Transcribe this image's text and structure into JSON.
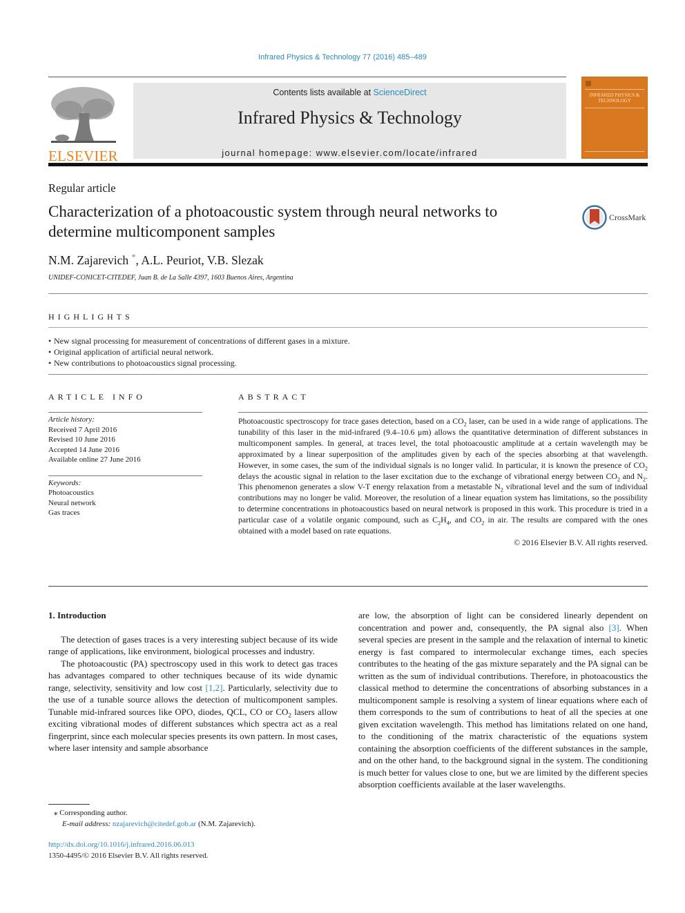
{
  "header": {
    "citation": "Infrared Physics & Technology 77 (2016) 485–489",
    "contents_prefix": "Contents lists available at ",
    "contents_link": "ScienceDirect",
    "journal_name": "Infrared Physics & Technology",
    "homepage": "journal homepage: www.elsevier.com/locate/infrared",
    "publisher_logo": "ELSEVIER",
    "cover_title": "INFRARED PHYSICS & TECHNOLOGY",
    "cover_color": "#d9781f",
    "link_color": "#2a8ab8",
    "publisher_color": "#f07f1a"
  },
  "article": {
    "type": "Regular article",
    "title": "Characterization of a photoacoustic system through neural networks to determine multicomponent samples",
    "crossmark_label": "CrossMark",
    "authors": [
      {
        "name": "N.M. Zajarevich",
        "marker": "*"
      },
      {
        "name": "A.L. Peuriot"
      },
      {
        "name": "V.B. Slezak"
      }
    ],
    "author_sep_1": ", ",
    "author_sep_2": ", ",
    "affiliation": "UNIDEF-CONICET-CITEDEF, Juan B. de La Salle 4397, 1603 Buenos Aires, Argentina"
  },
  "highlights": {
    "heading": "HIGHLIGHTS",
    "items": [
      "New signal processing for measurement of concentrations of different gases in a mixture.",
      "Original application of artificial neural network.",
      "New contributions to photoacoustics signal processing."
    ]
  },
  "article_info": {
    "heading": "ARTICLE INFO",
    "history_label": "Article history:",
    "history": [
      "Received 7 April 2016",
      "Revised 10 June 2016",
      "Accepted 14 June 2016",
      "Available online 27 June 2016"
    ],
    "keywords_label": "Keywords:",
    "keywords": [
      "Photoacoustics",
      "Neural network",
      "Gas traces"
    ]
  },
  "abstract": {
    "heading": "ABSTRACT",
    "p1": "Photoacoustic spectroscopy for trace gases detection, based on a CO",
    "p2": " laser, can be used in a wide range of applications. The tunability of this laser in the mid-infrared (9.4–10.6 μm) allows the quantitative determination of different substances in multicomponent samples. In general, at traces level, the total photoacoustic amplitude at a certain wavelength may be approximated by a linear superposition of the amplitudes given by each of the species absorbing at that wavelength. However, in some cases, the sum of the individual signals is no longer valid. In particular, it is known the presence of CO",
    "p3": " delays the acoustic signal in relation to the laser excitation due to the exchange of vibrational energy between CO",
    "p4": " and N",
    "p5": ". This phenomenon generates a slow V-T energy relaxation from a metastable N",
    "p6": " vibrational level and the sum of individual contributions may no longer be valid. Moreover, the resolution of a linear equation system has limitations, so the possibility to determine concentrations in photoacoustics based on neural network is proposed in this work. This procedure is tried in a particular case of a volatile organic compound, such as C",
    "p7": "H",
    "p8": ", and CO",
    "p9": " in air. The results are compared with the ones obtained with a model based on rate equations.",
    "sub2": "2",
    "sub4": "4",
    "copyright": "© 2016 Elsevier B.V. All rights reserved."
  },
  "introduction": {
    "heading": "1. Introduction",
    "para1": "The detection of gases traces is a very interesting subject because of its wide range of applications, like environment, biological processes and industry.",
    "para2_a": "The photoacoustic (PA) spectroscopy used in this work to detect gas traces has advantages compared to other techniques because of its wide dynamic range, selectivity, sensitivity and low cost ",
    "ref_1_2": "[1,2]",
    "para2_b": ". Particularly, selectivity due to the use of a tunable source allows the detection of multicomponent samples. Tunable mid-infrared sources like OPO, diodes, QCL, CO or CO",
    "para2_c": " lasers allow exciting vibrational modes of different substances which spectra act as a real fingerprint, since each molecular species presents its own pattern. In most cases, where laser intensity and sample absorbance",
    "col2_a": "are low, the absorption of light can be considered linearly dependent on concentration and power and, consequently, the PA signal also ",
    "ref_3": "[3]",
    "col2_b": ". When several species are present in the sample and the relaxation of internal to kinetic energy is fast compared to intermolecular exchange times, each species contributes to the heating of the gas mixture separately and the PA signal can be written as the sum of individual contributions. Therefore, in photoacoustics the classical method to determine the concentrations of absorbing substances in a multicomponent sample is resolving a system of linear equations where each of them corresponds to the sum of contributions to heat of all the species at one given excitation wavelength. This method has limitations related on one hand, to the conditioning of the matrix characteristic of the equations system containing the absorption coefficients of the different substances in the sample, and on the other hand, to the background signal in the system. The conditioning is much better for values close to one, but we are limited by the different species absorption coefficients available at the laser wavelengths."
  },
  "footnotes": {
    "marker": "⁎",
    "corresponding": "Corresponding author.",
    "email_label": "E-mail address: ",
    "email": "nzajarevich@citedef.gob.ar",
    "email_owner": " (N.M. Zajarevich).",
    "doi": "http://dx.doi.org/10.1016/j.infrared.2016.06.013",
    "issn_copyright": "1350-4495/© 2016 Elsevier B.V. All rights reserved."
  }
}
